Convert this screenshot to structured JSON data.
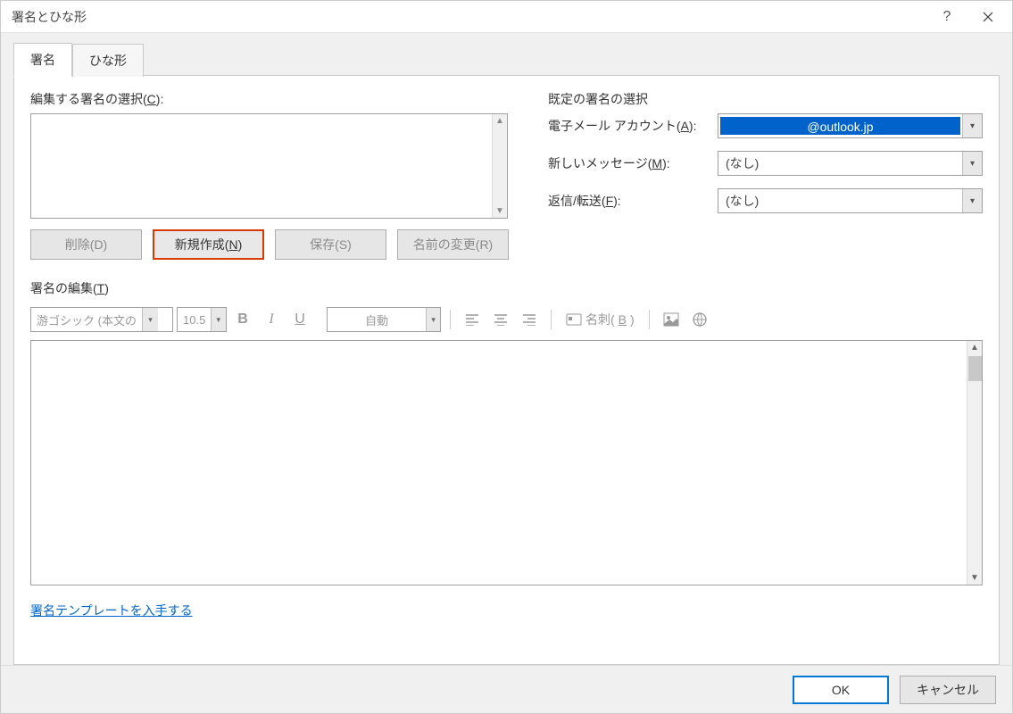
{
  "window": {
    "title": "署名とひな形"
  },
  "tabs": {
    "signature": "署名",
    "stationery": "ひな形"
  },
  "leftPane": {
    "selectLabelPre": "編集する署名の選択(",
    "selectHotkey": "C",
    "selectLabelPost": "):",
    "buttons": {
      "delete": "削除(D)",
      "newPre": "新規作成(",
      "newHotkey": "N",
      "newPost": ")",
      "save": "保存(S)",
      "rename": "名前の変更(R)"
    }
  },
  "rightPane": {
    "groupLabel": "既定の署名の選択",
    "accountLabelPre": "電子メール アカウント(",
    "accountHotkey": "A",
    "accountLabelPost": "):",
    "accountValue": "@outlook.jp",
    "newMsgLabelPre": "新しいメッセージ(",
    "newMsgHotkey": "M",
    "newMsgLabelPost": "):",
    "newMsgValue": "(なし)",
    "replyLabelPre": "返信/転送(",
    "replyHotkey": "F",
    "replyLabelPost": "):",
    "replyValue": "(なし)"
  },
  "editSection": {
    "labelPre": "署名の編集(",
    "hotkey": "T",
    "labelPost": ")",
    "fontName": "游ゴシック (本文の",
    "fontSize": "10.5",
    "colorAuto": "自動",
    "bizcardPre": "名刺(",
    "bizcardHotkey": "B",
    "bizcardPost": ")"
  },
  "link": {
    "templates": "署名テンプレートを入手する"
  },
  "dialog": {
    "ok": "OK",
    "cancel": "キャンセル"
  }
}
